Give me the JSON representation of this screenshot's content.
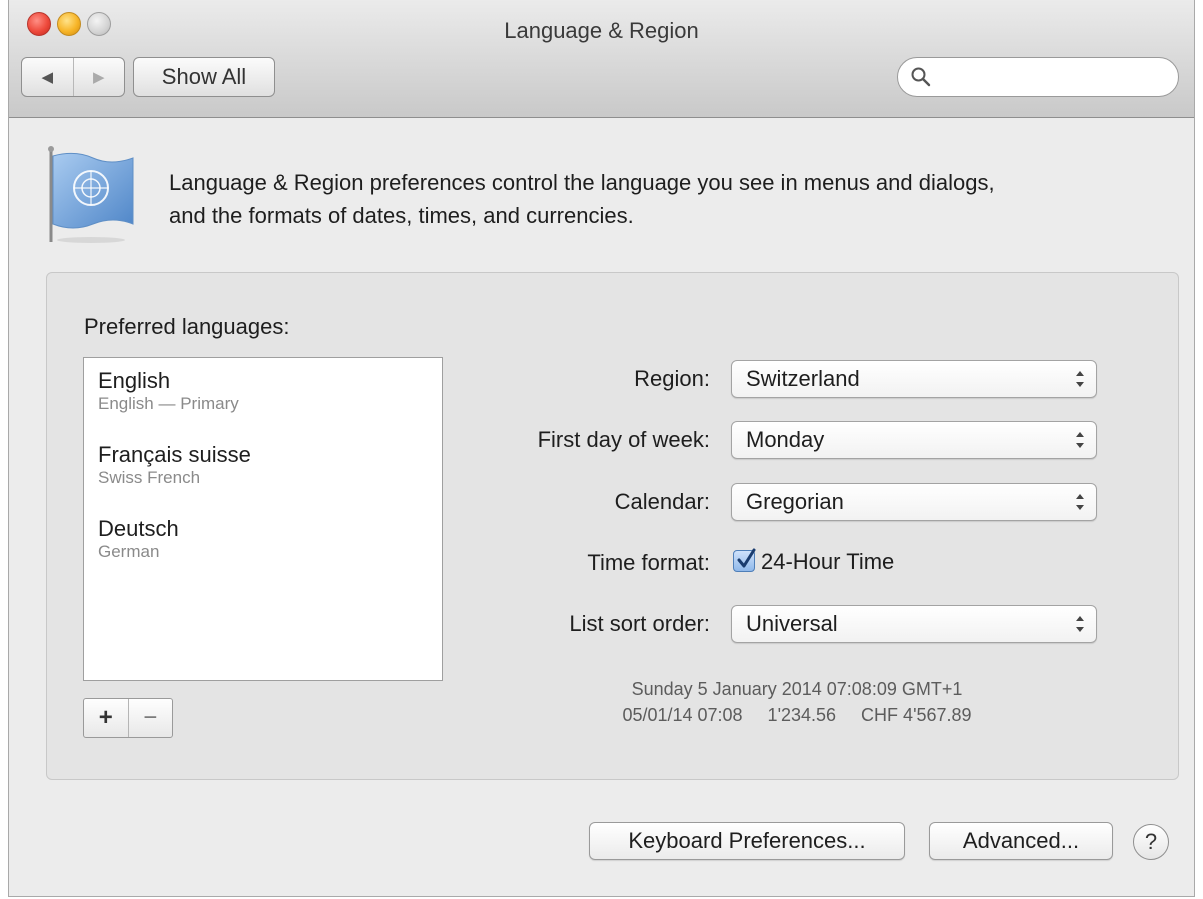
{
  "window": {
    "title": "Language & Region"
  },
  "toolbar": {
    "back_icon": "back-arrow-icon",
    "forward_icon": "forward-arrow-icon",
    "show_all_label": "Show All",
    "search_placeholder": "",
    "search_value": ""
  },
  "header": {
    "icon": "un-flag-icon",
    "description_line1": "Language & Region preferences control the language you see in menus and dialogs,",
    "description_line2": "and the formats of dates, times, and currencies."
  },
  "languages": {
    "label": "Preferred languages:",
    "items": [
      {
        "name": "English",
        "sub": "English — Primary"
      },
      {
        "name": "Français suisse",
        "sub": "Swiss French"
      },
      {
        "name": "Deutsch",
        "sub": "German"
      }
    ],
    "add_label": "+",
    "remove_label": "−"
  },
  "settings": {
    "region": {
      "label": "Region:",
      "value": "Switzerland"
    },
    "first_day": {
      "label": "First day of week:",
      "value": "Monday"
    },
    "calendar": {
      "label": "Calendar:",
      "value": "Gregorian"
    },
    "time_format": {
      "label": "Time format:",
      "checkbox_label": "24-Hour Time",
      "checked": true
    },
    "sort_order": {
      "label": "List sort order:",
      "value": "Universal"
    }
  },
  "sample": {
    "line1": "Sunday 5 January 2014 07:08:09 GMT+1",
    "line2": "05/01/14 07:08     1'234.56     CHF 4'567.89"
  },
  "buttons": {
    "keyboard": "Keyboard Preferences...",
    "advanced": "Advanced...",
    "help": "?"
  },
  "colors": {
    "window_bg": "#ececec",
    "group_bg": "#e4e4e4",
    "checkbox_accent": "#4f7fb8"
  }
}
